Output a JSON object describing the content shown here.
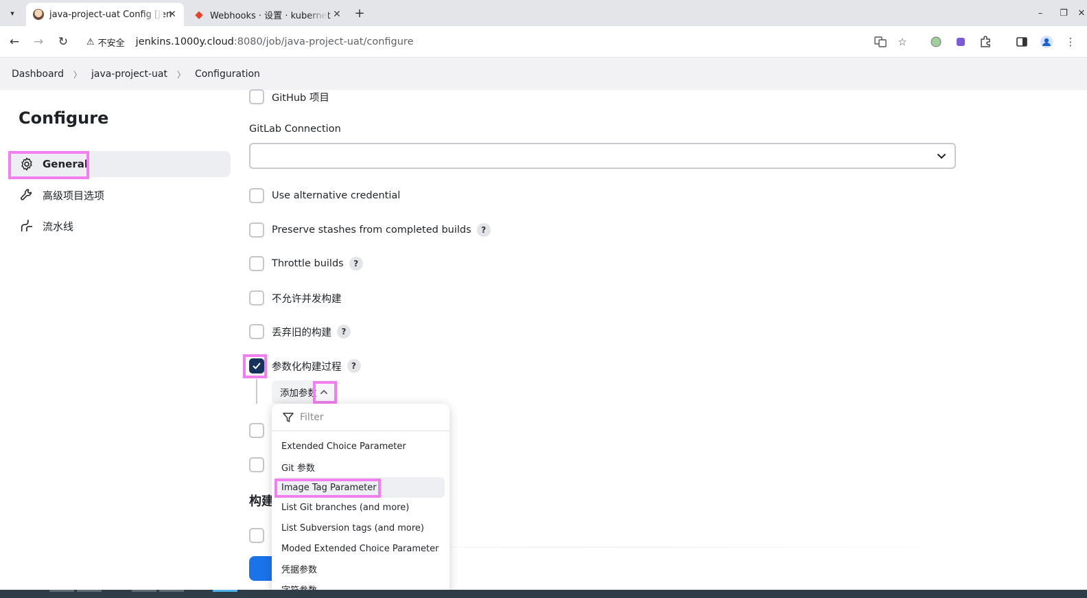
{
  "browser": {
    "tabs": [
      {
        "title": "java-project-uat Config [Jen",
        "active": true
      },
      {
        "title": "Webhooks · 设置 · kubernet",
        "active": false
      }
    ],
    "address": {
      "security_label": "不安全",
      "url_host": "jenkins.1000y.cloud",
      "url_rest": ":8080/job/java-project-uat/configure"
    }
  },
  "breadcrumbs": {
    "items": [
      "Dashboard",
      "java-project-uat",
      "Configuration"
    ]
  },
  "sidebar": {
    "title": "Configure",
    "items": [
      {
        "label": "General",
        "icon": "gear-icon",
        "selected": true
      },
      {
        "label": "高级项目选项",
        "icon": "wrench-icon",
        "selected": false
      },
      {
        "label": "流水线",
        "icon": "pipeline-icon",
        "selected": false
      }
    ]
  },
  "main": {
    "github_project": "GitHub 项目",
    "gitlab_connection_label": "GitLab Connection",
    "gitlab_connection_value": "",
    "options": [
      {
        "label": "Use alternative credential",
        "checked": false,
        "help": false
      },
      {
        "label": "Preserve stashes from completed builds",
        "checked": false,
        "help": true
      },
      {
        "label": "Throttle builds",
        "checked": false,
        "help": true
      },
      {
        "label": "不允许并发构建",
        "checked": false,
        "help": false
      },
      {
        "label": "丢弃旧的构建",
        "checked": false,
        "help": true
      },
      {
        "label": "参数化构建过程",
        "checked": true,
        "help": true
      }
    ],
    "help_glyph": "?",
    "add_param_label": "添加参数",
    "section_heading": "构建"
  },
  "dropdown": {
    "filter_placeholder": "Filter",
    "items": [
      "Extended Choice Parameter",
      "Git 参数",
      "Image Tag Parameter",
      "List Git branches (and more)",
      "List Subversion tags (and more)",
      "Moded Extended Choice Parameter",
      "凭据参数",
      "字符参数"
    ],
    "hovered_item": "Image Tag Parameter"
  },
  "colors": {
    "accent_highlight": "#f27ff0",
    "checkbox_checked": "#14325c",
    "primary_button": "#1a73e8"
  }
}
